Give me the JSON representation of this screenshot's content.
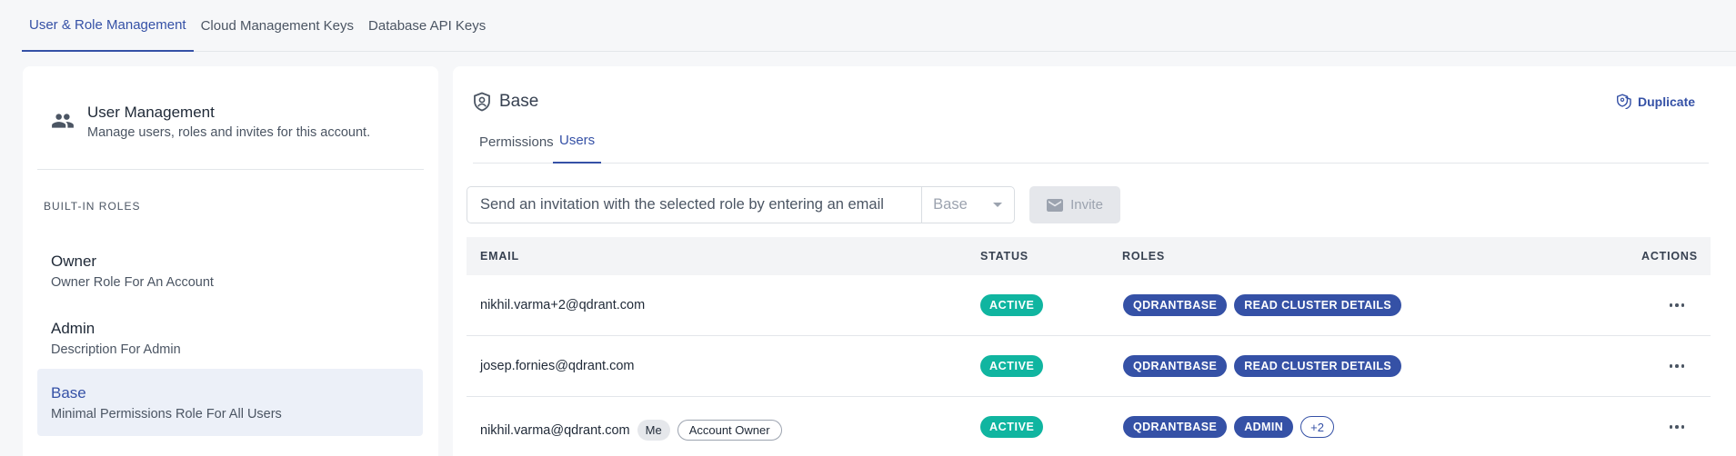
{
  "top_tabs": [
    {
      "label": "User & Role Management",
      "active": true
    },
    {
      "label": "Cloud Management Keys",
      "active": false
    },
    {
      "label": "Database API Keys",
      "active": false
    }
  ],
  "user_management": {
    "icon": "people-icon",
    "title": "User Management",
    "description": "Manage users, roles and invites for this account."
  },
  "built_in_roles": {
    "heading": "BUILT-IN ROLES",
    "items": [
      {
        "name": "Owner",
        "description": "Owner Role For An Account",
        "active": false
      },
      {
        "name": "Admin",
        "description": "Description For Admin",
        "active": false
      },
      {
        "name": "Base",
        "description": "Minimal Permissions Role For All Users",
        "active": true
      }
    ]
  },
  "role_panel": {
    "icon": "shield-person-icon",
    "title": "Base",
    "duplicate_label": "Duplicate",
    "duplicate_icon": "shield-copy-icon",
    "tabs": [
      {
        "label": "Permissions",
        "active": false
      },
      {
        "label": "Users",
        "active": true
      }
    ]
  },
  "invite": {
    "placeholder": "Send an invitation with the selected role by entering an email",
    "value": "",
    "selected_role": "Base",
    "button_label": "Invite",
    "button_icon": "mail-icon"
  },
  "table": {
    "columns": [
      "EMAIL",
      "STATUS",
      "ROLES",
      "ACTIONS"
    ],
    "rows": [
      {
        "email": "nikhil.varma+2@qdrant.com",
        "tags": [],
        "status": "ACTIVE",
        "roles": [
          "QDRANTBASE",
          "READ CLUSTER DETAILS"
        ],
        "more": ""
      },
      {
        "email": "josep.fornies@qdrant.com",
        "tags": [],
        "status": "ACTIVE",
        "roles": [
          "QDRANTBASE",
          "READ CLUSTER DETAILS"
        ],
        "more": ""
      },
      {
        "email": "nikhil.varma@qdrant.com",
        "tags": [
          "Me",
          "Account Owner"
        ],
        "status": "ACTIVE",
        "roles": [
          "QDRANTBASE",
          "ADMIN"
        ],
        "more": "+2"
      }
    ]
  },
  "colors": {
    "accent": "#3551a6",
    "status_active": "#10b5a0",
    "background": "#f6f7f9"
  }
}
